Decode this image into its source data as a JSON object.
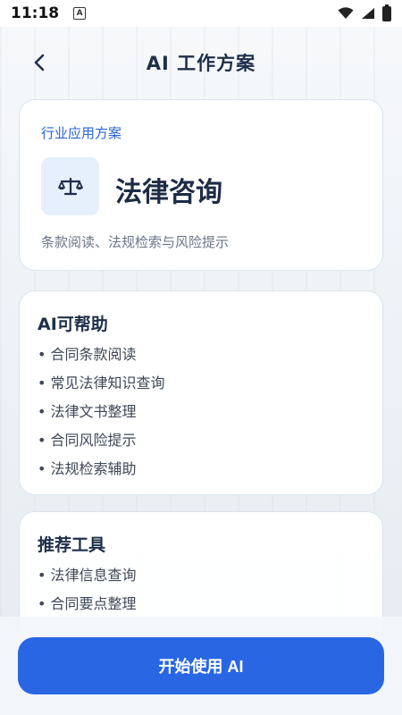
{
  "status_bar": {
    "time": "11:18",
    "indicator": "A",
    "icons": [
      "wifi-icon",
      "signal-icon",
      "battery-icon"
    ]
  },
  "header": {
    "title": "AI 工作方案",
    "back_icon": "chevron-left-icon"
  },
  "solution": {
    "tag": "行业应用方案",
    "icon": "scale-icon",
    "title": "法律咨询",
    "description": "条款阅读、法规检索与风险提示"
  },
  "ai_help": {
    "heading": "AI可帮助",
    "items": [
      "合同条款阅读",
      "常见法律知识查询",
      "法律文书整理",
      "合同风险提示",
      "法规检索辅助"
    ]
  },
  "tools": {
    "heading": "推荐工具",
    "items": [
      "法律信息查询",
      "合同要点整理"
    ]
  },
  "action": {
    "start_label": "开始使用 AI"
  },
  "colors": {
    "accent": "#2866e4",
    "tag": "#2a62d8",
    "icon_bg": "#e6effc"
  }
}
